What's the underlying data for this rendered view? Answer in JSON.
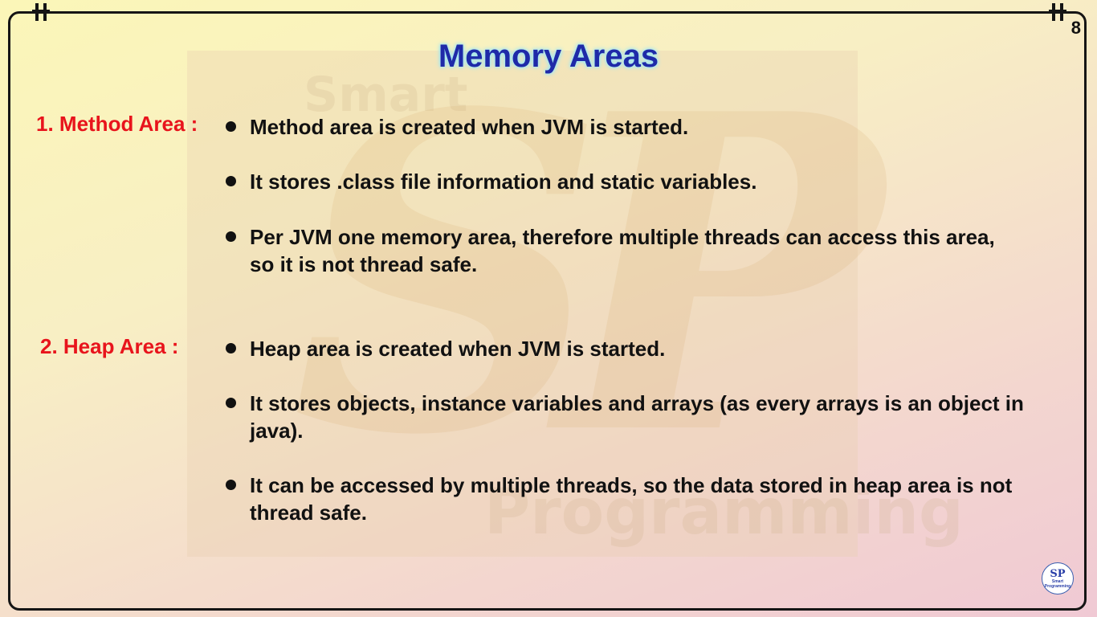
{
  "slide": {
    "page_number": "8",
    "title": "Memory Areas"
  },
  "watermark": {
    "letters": "SP",
    "word_top": "Smart",
    "word_bottom": "Programming"
  },
  "sections": [
    {
      "label": "1. Method Area :",
      "bullets": [
        "Method area is created when JVM is started.",
        "It stores .class file information and static variables.",
        "Per JVM one memory area, therefore multiple threads can access this area, so it is not thread safe."
      ]
    },
    {
      "label": "2. Heap Area :",
      "bullets": [
        "Heap area is created when JVM is started.",
        "It stores objects, instance variables and arrays (as every arrays is an object in java).",
        "It can be accessed by multiple threads, so the data stored in heap area is not thread safe."
      ]
    }
  ],
  "logo": {
    "letters": "SP",
    "line1": "Smart",
    "line2": "Programming"
  },
  "colors": {
    "title": "#1f2aa8",
    "section_label": "#e8141c",
    "body_text": "#111111"
  }
}
